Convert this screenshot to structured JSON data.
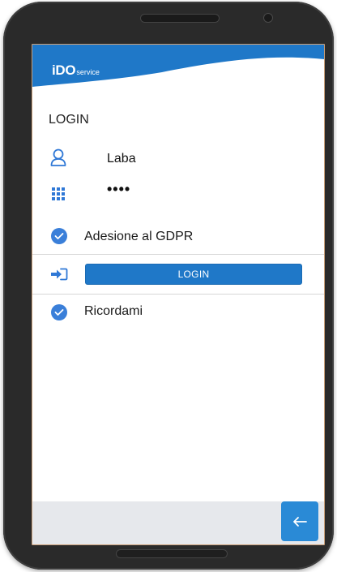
{
  "app": {
    "brand_main": "iDO",
    "brand_sub": "service"
  },
  "login": {
    "title": "LOGIN",
    "username": "Laba",
    "password_masked": "••••",
    "gdpr_label": "Adesione al GDPR",
    "gdpr_checked": true,
    "login_button_label": "LOGIN",
    "remember_label": "Ricordami",
    "remember_checked": true
  },
  "icons": {
    "user": "user-icon",
    "password": "keypad-icon",
    "signin": "sign-in-icon",
    "check": "check-icon",
    "back": "arrow-left-icon"
  },
  "colors": {
    "brand_blue": "#1f78c8",
    "check_blue": "#3a7fd9",
    "footer_bg": "#e6e8ec",
    "back_button": "#2a8ad6"
  }
}
